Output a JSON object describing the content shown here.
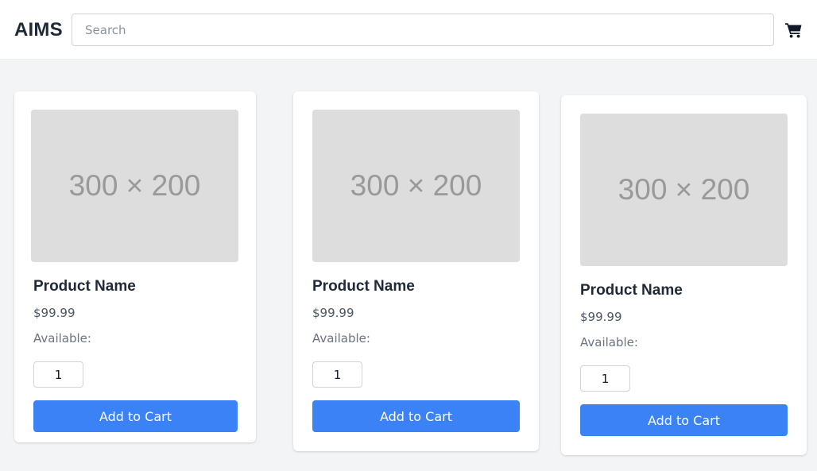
{
  "header": {
    "logo": "AIMS",
    "search_placeholder": "Search",
    "cart_icon": "shopping-cart-icon"
  },
  "colors": {
    "accent": "#3b82f6",
    "page_background": "#f3f4f6",
    "placeholder_image": "#dddddd"
  },
  "products": [
    {
      "image_text": "300 × 200",
      "name": "Product Name",
      "price": "$99.99",
      "availability_label": "Available:",
      "quantity": "1",
      "add_label": "Add to Cart"
    },
    {
      "image_text": "300 × 200",
      "name": "Product Name",
      "price": "$99.99",
      "availability_label": "Available:",
      "quantity": "1",
      "add_label": "Add to Cart"
    },
    {
      "image_text": "300 × 200",
      "name": "Product Name",
      "price": "$99.99",
      "availability_label": "Available:",
      "quantity": "1",
      "add_label": "Add to Cart"
    }
  ]
}
